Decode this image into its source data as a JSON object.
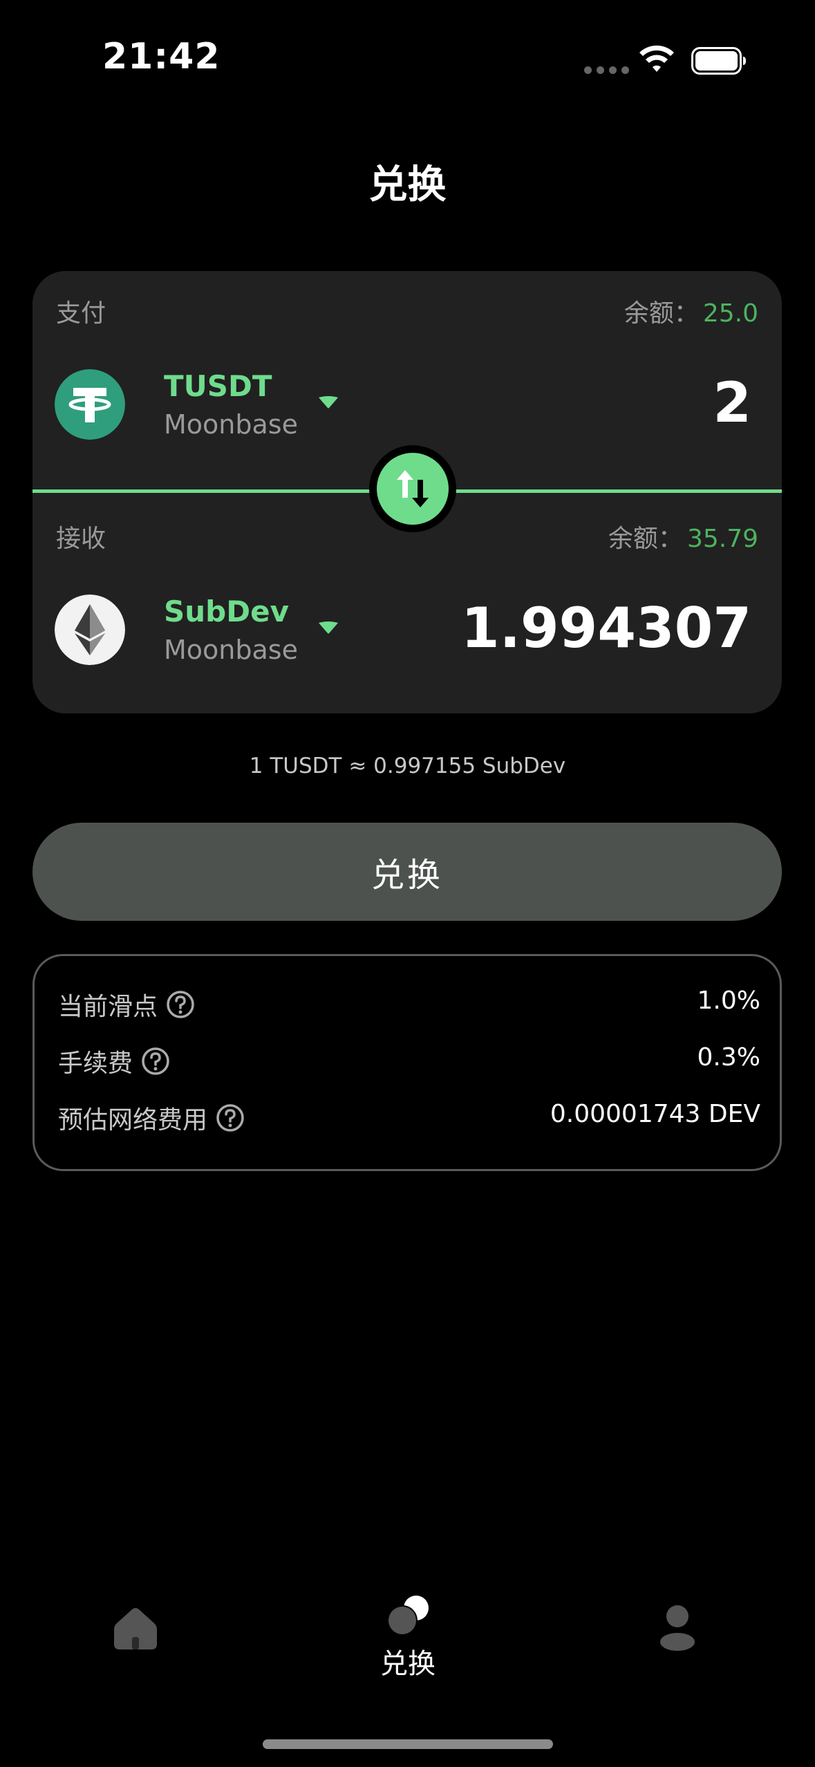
{
  "status_bar": {
    "time": "21:42"
  },
  "header": {
    "title": "兑换"
  },
  "swap_card": {
    "pay": {
      "label": "支付",
      "balance_label": "余额：",
      "balance_value": "25.0",
      "token_name": "TUSDT",
      "token_chain": "Moonbase",
      "token_icon": "tether-icon",
      "amount": "2"
    },
    "receive": {
      "label": "接收",
      "balance_label": "余额：",
      "balance_value": "35.79",
      "token_name": "SubDev",
      "token_chain": "Moonbase",
      "token_icon": "ethereum-icon",
      "amount": "1.994307"
    }
  },
  "rate": "1 TUSDT ≈ 0.997155 SubDev",
  "swap_button": {
    "label": "兑换"
  },
  "info": {
    "rows": [
      {
        "label": "当前滑点",
        "value": "1.0%"
      },
      {
        "label": "手续费",
        "value": "0.3%"
      },
      {
        "label": "预估网络费用",
        "value": "0.00001743 DEV"
      }
    ]
  },
  "tab_bar": {
    "tabs": [
      {
        "icon": "home-icon",
        "label": ""
      },
      {
        "icon": "swap-icon",
        "label": "兑换",
        "active": true
      },
      {
        "icon": "profile-icon",
        "label": ""
      }
    ]
  },
  "colors": {
    "accent": "#6fdc8c",
    "balance": "#4cb35f",
    "card": "#212121",
    "button": "#4d524f",
    "tether": "#2f9e7c"
  }
}
